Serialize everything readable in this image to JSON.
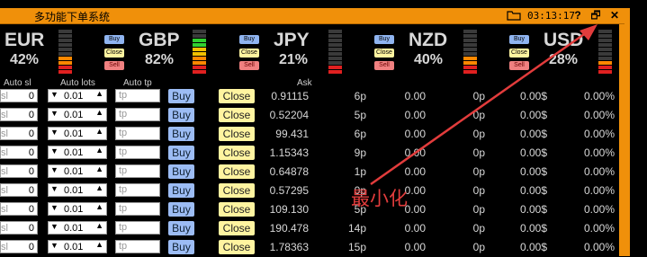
{
  "window": {
    "title": "多功能下单系统",
    "time": "03:13:17",
    "icons": [
      "folder-icon",
      "help-icon",
      "restore-icon",
      "close-icon"
    ],
    "help_glyph": "?",
    "restore_glyph": "🗗",
    "close_glyph": "✕"
  },
  "currencies": [
    {
      "code": "EUR",
      "pct": "42%",
      "level": 0.42
    },
    {
      "code": "GBP",
      "pct": "82%",
      "level": 0.82
    },
    {
      "code": "JPY",
      "pct": "21%",
      "level": 0.21
    },
    {
      "code": "NZD",
      "pct": "40%",
      "level": 0.4
    },
    {
      "code": "USD",
      "pct": "28%",
      "level": 0.28
    }
  ],
  "mini_buttons": {
    "buy": "Buy",
    "close": "Close",
    "sell": "Sell"
  },
  "headers": {
    "auto_sl": "Auto sl",
    "auto_lots": "Auto lots",
    "auto_tp": "Auto tp",
    "ask": "Ask"
  },
  "rows": [
    {
      "sl": "0",
      "lots": "0.01",
      "tp": "tp",
      "buy": "Buy",
      "close": "Close",
      "ask": "0.91115",
      "spread": "6p",
      "v1": "0.00",
      "v2": "0p",
      "v3": "0.00$",
      "v4": "0.00%"
    },
    {
      "sl": "0",
      "lots": "0.01",
      "tp": "tp",
      "buy": "Buy",
      "close": "Close",
      "ask": "0.52204",
      "spread": "5p",
      "v1": "0.00",
      "v2": "0p",
      "v3": "0.00$",
      "v4": "0.00%"
    },
    {
      "sl": "0",
      "lots": "0.01",
      "tp": "tp",
      "buy": "Buy",
      "close": "Close",
      "ask": "99.431",
      "spread": "6p",
      "v1": "0.00",
      "v2": "0p",
      "v3": "0.00$",
      "v4": "0.00%"
    },
    {
      "sl": "0",
      "lots": "0.01",
      "tp": "tp",
      "buy": "Buy",
      "close": "Close",
      "ask": "1.15343",
      "spread": "9p",
      "v1": "0.00",
      "v2": "0p",
      "v3": "0.00$",
      "v4": "0.00%"
    },
    {
      "sl": "0",
      "lots": "0.01",
      "tp": "tp",
      "buy": "Buy",
      "close": "Close",
      "ask": "0.64878",
      "spread": "1p",
      "v1": "0.00",
      "v2": "0p",
      "v3": "0.00$",
      "v4": "0.00%"
    },
    {
      "sl": "0",
      "lots": "0.01",
      "tp": "tp",
      "buy": "Buy",
      "close": "Close",
      "ask": "0.57295",
      "spread": "0p",
      "v1": "0.00",
      "v2": "0p",
      "v3": "0.00$",
      "v4": "0.00%"
    },
    {
      "sl": "0",
      "lots": "0.01",
      "tp": "tp",
      "buy": "Buy",
      "close": "Close",
      "ask": "109.130",
      "spread": "5p",
      "v1": "0.00",
      "v2": "0p",
      "v3": "0.00$",
      "v4": "0.00%"
    },
    {
      "sl": "0",
      "lots": "0.01",
      "tp": "tp",
      "buy": "Buy",
      "close": "Close",
      "ask": "190.478",
      "spread": "14p",
      "v1": "0.00",
      "v2": "0p",
      "v3": "0.00$",
      "v4": "0.00%"
    },
    {
      "sl": "0",
      "lots": "0.01",
      "tp": "tp",
      "buy": "Buy",
      "close": "Close",
      "ask": "1.78363",
      "spread": "15p",
      "v1": "0.00",
      "v2": "0p",
      "v3": "0.00$",
      "v4": "0.00%"
    }
  ],
  "annotation": {
    "text": "最小化",
    "color": "#e23c3c"
  },
  "colors": {
    "accent": "#f0900a",
    "bar_red": "#e02020",
    "bar_orange": "#ff8800",
    "bar_yellow": "#f0c000",
    "bar_green": "#30d030",
    "bar_empty": "#3a3a3a"
  }
}
